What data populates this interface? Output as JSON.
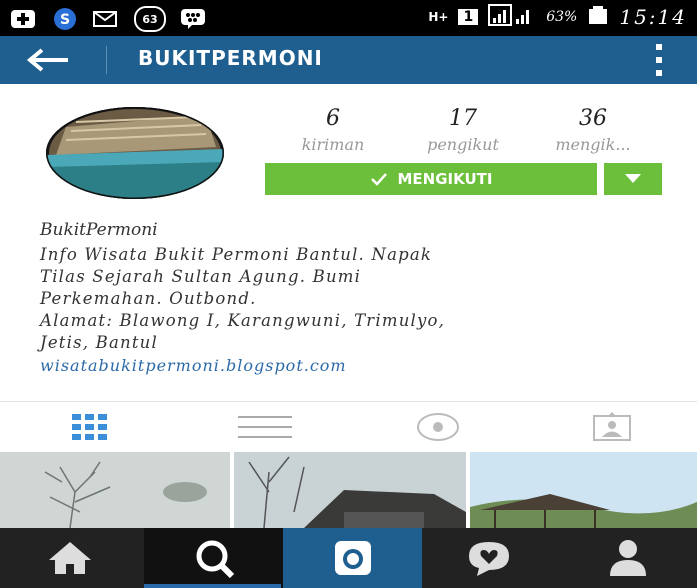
{
  "status_bar": {
    "badge_count": "63",
    "network": "H+",
    "sim": "1",
    "battery": "63%",
    "time": "15:14"
  },
  "app_bar": {
    "title": "BUKITPERMONI"
  },
  "profile": {
    "stats": [
      {
        "value": "6",
        "label": "kiriman"
      },
      {
        "value": "17",
        "label": "pengikut"
      },
      {
        "value": "36",
        "label": "mengik..."
      }
    ],
    "follow_button_label": "MENGIKUTI",
    "bio": {
      "name": "BukitPermoni",
      "line1": "Info Wisata Bukit Permoni Bantul. Napak",
      "line2": "Tilas Sejarah Sultan Agung. Bumi",
      "line3": "Perkemahan. Outbond.",
      "line4": "Alamat: Blawong I, Karangwuni, Trimulyo,",
      "line5": "Jetis, Bantul",
      "link": "wisatabukitpermoni.blogspot.com"
    }
  },
  "tabs": [
    {
      "icon": "grid-icon",
      "active": true
    },
    {
      "icon": "list-icon",
      "active": false
    },
    {
      "icon": "location-icon",
      "active": false
    },
    {
      "icon": "tagged-photos-icon",
      "active": false
    }
  ],
  "bottom_nav": [
    {
      "icon": "home-icon"
    },
    {
      "icon": "search-icon",
      "active": true
    },
    {
      "icon": "camera-icon"
    },
    {
      "icon": "activity-heart-icon"
    },
    {
      "icon": "profile-icon"
    }
  ],
  "colors": {
    "app_bar": "#1e5f8f",
    "follow_button": "#6cbf3a",
    "link": "#2b6aa8",
    "nav_bg": "#222222",
    "nav_camera_bg": "#1e5f8f"
  }
}
